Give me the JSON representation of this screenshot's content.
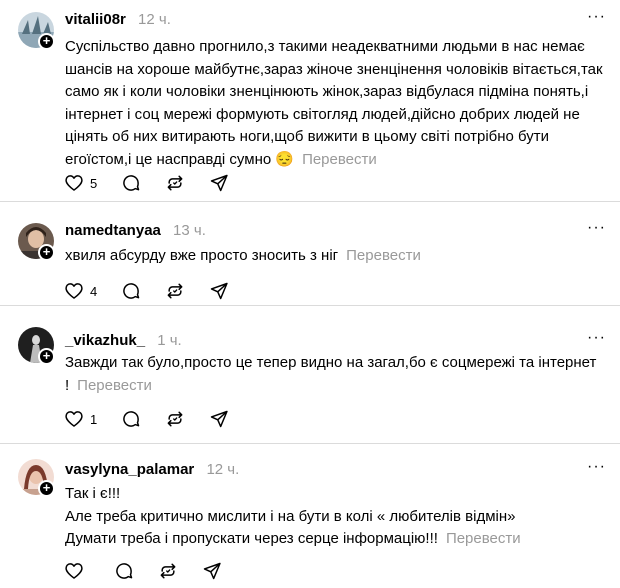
{
  "posts": [
    {
      "username": "vitalii08r",
      "time": "12 ч.",
      "lines": [
        "Суспільство давно прогнило,з такими неадекватними людьми в нас немає",
        "шансів на хороше майбутнє,зараз жіноче зненцінення чоловіків вітається,так",
        "само як і коли чоловіки зненцінюють жінок,зараз відбулася підміна понять,і",
        "інтернет і соц мережі формують світогляд людей,дійсно добрих людей не",
        "цінять об них витирають ноги,щоб вижити в цьому світі потрібно бути",
        "егоїстом,і це насправді сумно 😔"
      ],
      "translate": "Перевести",
      "likes": "5"
    },
    {
      "username": "namedtanyaa",
      "time": "13 ч.",
      "lines": [
        "хвиля абсурду вже просто зносить з ніг"
      ],
      "translate": "Перевести",
      "likes": "4"
    },
    {
      "username": "_vikazhuk_",
      "time": "1 ч.",
      "lines": [
        "Завжди так було,просто це тепер видно на загал,бо є соцмережі та інтернет",
        "!"
      ],
      "translate": "Перевести",
      "likes": "1"
    },
    {
      "username": "vasylyna_palamar",
      "time": "12 ч.",
      "lines": [
        "Так і є!!!",
        "Але треба критично мислити і на бути в колі « любителів відмін»",
        "Думати треба і пропускати через серце інформацію!!!"
      ],
      "translate": "Перевести",
      "likes": ""
    }
  ],
  "more_label": "···",
  "colors": {
    "muted": "#999999",
    "divider": "#dbdbdb"
  },
  "icons": [
    "heart-icon",
    "comment-icon",
    "repost-icon",
    "share-icon",
    "more-icon",
    "follow-plus-icon"
  ]
}
